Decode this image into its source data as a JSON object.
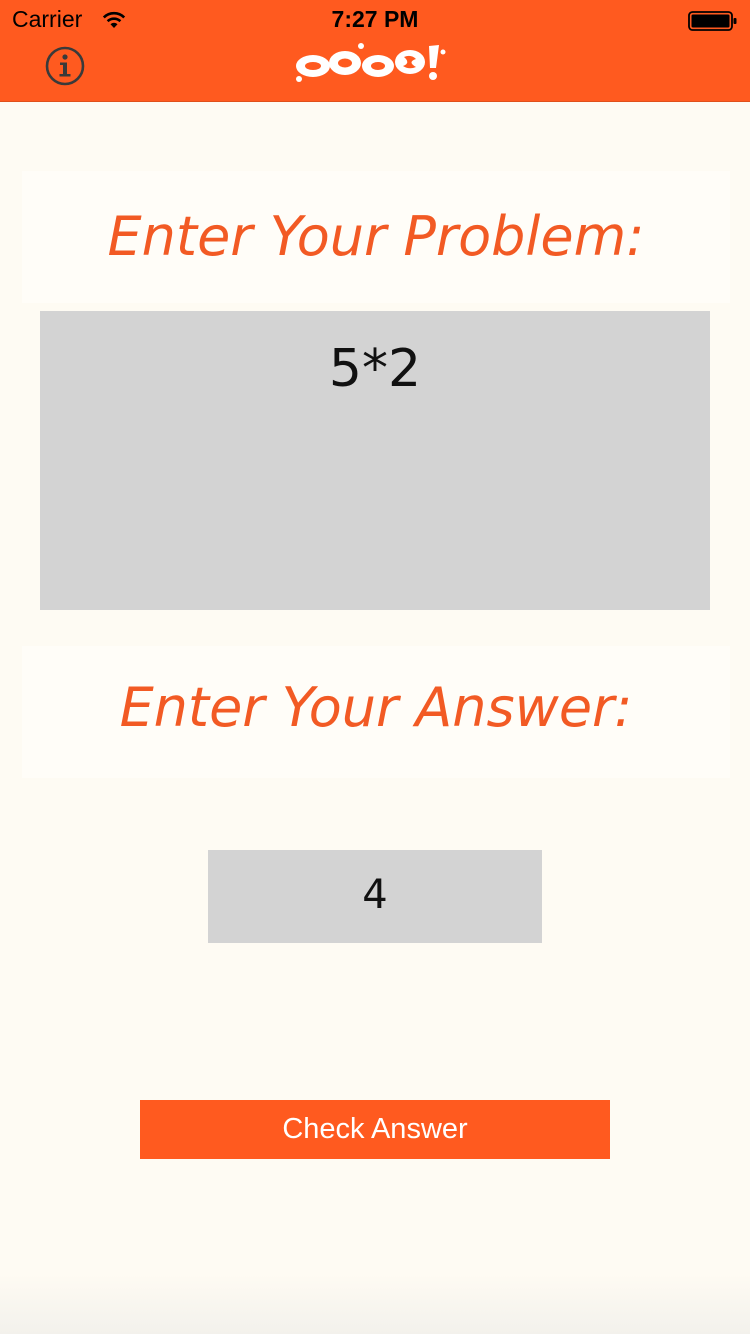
{
  "status_bar": {
    "carrier": "Carrier",
    "time": "7:27 PM",
    "wifi_icon": "wifi-icon",
    "battery_icon": "battery-full-icon"
  },
  "nav": {
    "info_icon": "info-icon",
    "logo_text": "OOPS!",
    "background_color": "#ff5a1f"
  },
  "problem": {
    "label": "Enter Your Problem:",
    "value": "5*2"
  },
  "answer": {
    "label": "Enter Your Answer:",
    "value": "4"
  },
  "check_button": {
    "label": "Check Answer"
  },
  "colors": {
    "accent": "#ff5a1f",
    "label_text": "#f25a24",
    "input_bg": "#d3d3d3",
    "page_bg": "#fefbf3"
  }
}
